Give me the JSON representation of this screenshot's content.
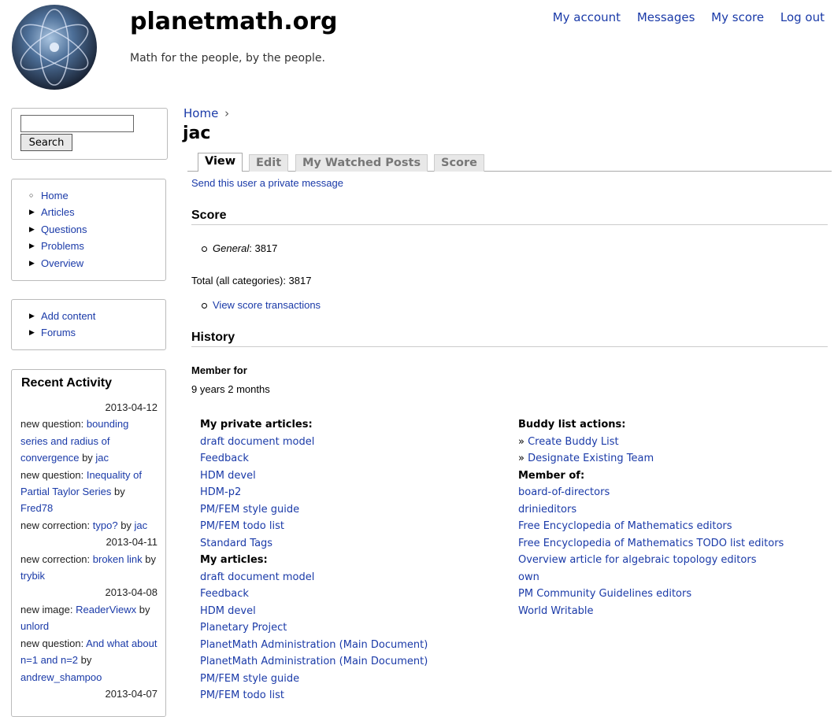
{
  "header": {
    "site_name": "planetmath.org",
    "slogan": "Math for the people, by the people.",
    "nav": [
      "My account",
      "Messages",
      "My score",
      "Log out"
    ]
  },
  "sidebar": {
    "search_value": "",
    "search_button": "Search",
    "menu1": [
      "Home",
      "Articles",
      "Questions",
      "Problems",
      "Overview"
    ],
    "menu2": [
      "Add content",
      "Forums"
    ],
    "recent_activity": {
      "title": "Recent Activity",
      "entries": [
        {
          "type": "date",
          "text": "2013-04-12"
        },
        {
          "type": "item",
          "prefix": "new question: ",
          "link": "bounding series and radius of convergence",
          "by": " by ",
          "user": "jac"
        },
        {
          "type": "item",
          "prefix": "new question: ",
          "link": "Inequality of Partial Taylor Series",
          "by": " by ",
          "user": "Fred78"
        },
        {
          "type": "item",
          "prefix": "new correction: ",
          "link": "typo?",
          "by": " by ",
          "user": "jac"
        },
        {
          "type": "date",
          "text": "2013-04-11"
        },
        {
          "type": "item",
          "prefix": "new correction: ",
          "link": "broken link",
          "by": " by ",
          "user": "trybik"
        },
        {
          "type": "date",
          "text": "2013-04-08"
        },
        {
          "type": "item",
          "prefix": "new image: ",
          "link": "ReaderViewx",
          "by": " by ",
          "user": "unlord"
        },
        {
          "type": "item",
          "prefix": "new question: ",
          "link": "And what about n=1 and n=2",
          "by": " by ",
          "user": "andrew_shampoo"
        },
        {
          "type": "date",
          "text": "2013-04-07"
        }
      ]
    }
  },
  "main": {
    "breadcrumb_home": "Home",
    "breadcrumb_sep": "›",
    "title": "jac",
    "tabs": [
      "View",
      "Edit",
      "My Watched Posts",
      "Score"
    ],
    "private_message_link": "Send this user a private message",
    "score_heading": "Score",
    "score_category": "General",
    "score_value": ": 3817",
    "total_label": "Total (all categories): 3817",
    "view_transactions": "View score transactions",
    "history_heading": "History",
    "member_for_label": "Member for",
    "member_for_value": "9 years 2 months",
    "private_articles_heading": "My private articles:",
    "private_articles": [
      "draft document model",
      "Feedback",
      "HDM devel",
      "HDM-p2",
      "PM/FEM style guide",
      "PM/FEM todo list",
      "Standard Tags"
    ],
    "articles_heading": "My articles:",
    "articles": [
      "draft document model",
      "Feedback",
      "HDM devel",
      "Planetary Project",
      "PlanetMath Administration (Main Document)",
      "PlanetMath Administration (Main Document)",
      "PM/FEM style guide",
      "PM/FEM todo list"
    ],
    "buddy_heading": "Buddy list actions:",
    "buddy_actions": [
      "Create Buddy List",
      "Designate Existing Team"
    ],
    "member_of_heading": "Member of:",
    "member_of": [
      "board-of-directors",
      "drinieditors",
      "Free Encyclopedia of Mathematics editors",
      "Free Encyclopedia of Mathematics TODO list editors",
      "Overview article for algebraic topology editors",
      "own",
      "PM Community Guidelines editors",
      "World Writable"
    ]
  }
}
